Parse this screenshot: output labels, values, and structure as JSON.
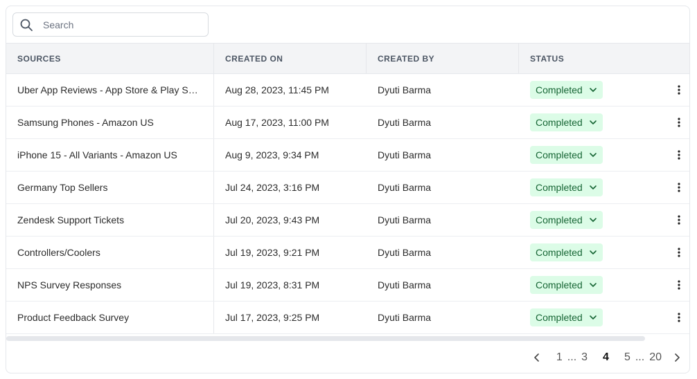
{
  "search": {
    "placeholder": "Search"
  },
  "columns": [
    "SOURCES",
    "CREATED ON",
    "CREATED BY",
    "STATUS"
  ],
  "rows": [
    {
      "source": "Uber App Reviews - App Store & Play Store",
      "created_on": "Aug 28, 2023, 11:45 PM",
      "created_by": "Dyuti Barma",
      "status": "Completed"
    },
    {
      "source": "Samsung Phones - Amazon US",
      "created_on": "Aug 17, 2023, 11:00 PM",
      "created_by": "Dyuti Barma",
      "status": "Completed"
    },
    {
      "source": "iPhone 15 - All Variants - Amazon US",
      "created_on": "Aug 9, 2023, 9:34 PM",
      "created_by": "Dyuti Barma",
      "status": "Completed"
    },
    {
      "source": "Germany Top Sellers",
      "created_on": "Jul 24, 2023, 3:16 PM",
      "created_by": "Dyuti Barma",
      "status": "Completed"
    },
    {
      "source": "Zendesk Support Tickets",
      "created_on": "Jul 20, 2023, 9:43 PM",
      "created_by": "Dyuti Barma",
      "status": "Completed"
    },
    {
      "source": "Controllers/Coolers",
      "created_on": "Jul 19, 2023, 9:21 PM",
      "created_by": "Dyuti Barma",
      "status": "Completed"
    },
    {
      "source": "NPS Survey Responses",
      "created_on": "Jul 19, 2023, 8:31 PM",
      "created_by": "Dyuti Barma",
      "status": "Completed"
    },
    {
      "source": "Product Feedback Survey",
      "created_on": "Jul 17, 2023, 9:25 PM",
      "created_by": "Dyuti Barma",
      "status": "Completed"
    }
  ],
  "pagination": {
    "pages": [
      "1",
      "...",
      "3",
      "4",
      "5",
      "...",
      "20"
    ],
    "current": "4"
  },
  "colors": {
    "status_bg": "#dcfce7",
    "status_text": "#166534",
    "header_bg": "#f3f4f6"
  },
  "icons": {
    "search": "search-icon",
    "status_dropdown": "chevron-down-icon",
    "row_menu": "more-vertical-icon",
    "prev": "chevron-left-icon",
    "next": "chevron-right-icon"
  }
}
